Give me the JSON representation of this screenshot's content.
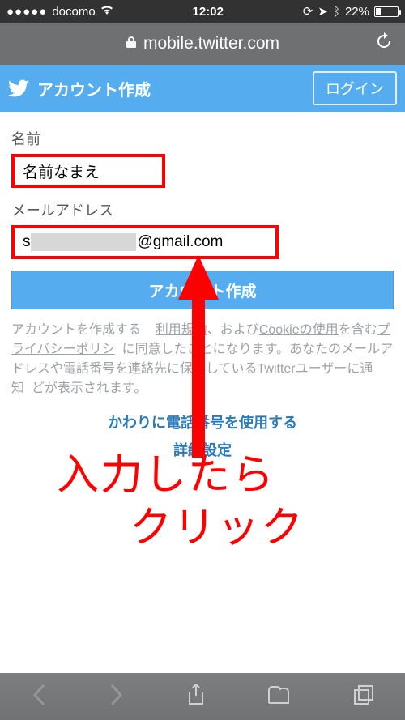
{
  "statusbar": {
    "carrier": "docomo",
    "time": "12:02",
    "battery_pct": "22%"
  },
  "urlbar": {
    "domain": "mobile.twitter.com"
  },
  "twheader": {
    "title": "アカウント作成",
    "login": "ログイン"
  },
  "form": {
    "name_label": "名前",
    "name_value": "名前なまえ",
    "email_label": "メールアドレス",
    "email_prefix": "s",
    "email_suffix": "@gmail.com"
  },
  "submit_label": "アカウント作成",
  "terms": {
    "t1": "アカウントを作成する",
    "link_terms": "利用規約",
    "t2": "、および",
    "link_cookie": "Cookieの使用",
    "t3": "を含む",
    "link_privacy": "プライバシーポリシ",
    "t4": "に同意したことになります。あなたのメールアドレスや電話番号を連絡先に保存しているTwitterユーザーに通知",
    "t5": "どが表示されます。"
  },
  "links": {
    "phone": "かわりに電話番号を使用する",
    "advanced": "詳細設定"
  },
  "annotation": {
    "line1": "入力したら",
    "line2": "クリック"
  }
}
